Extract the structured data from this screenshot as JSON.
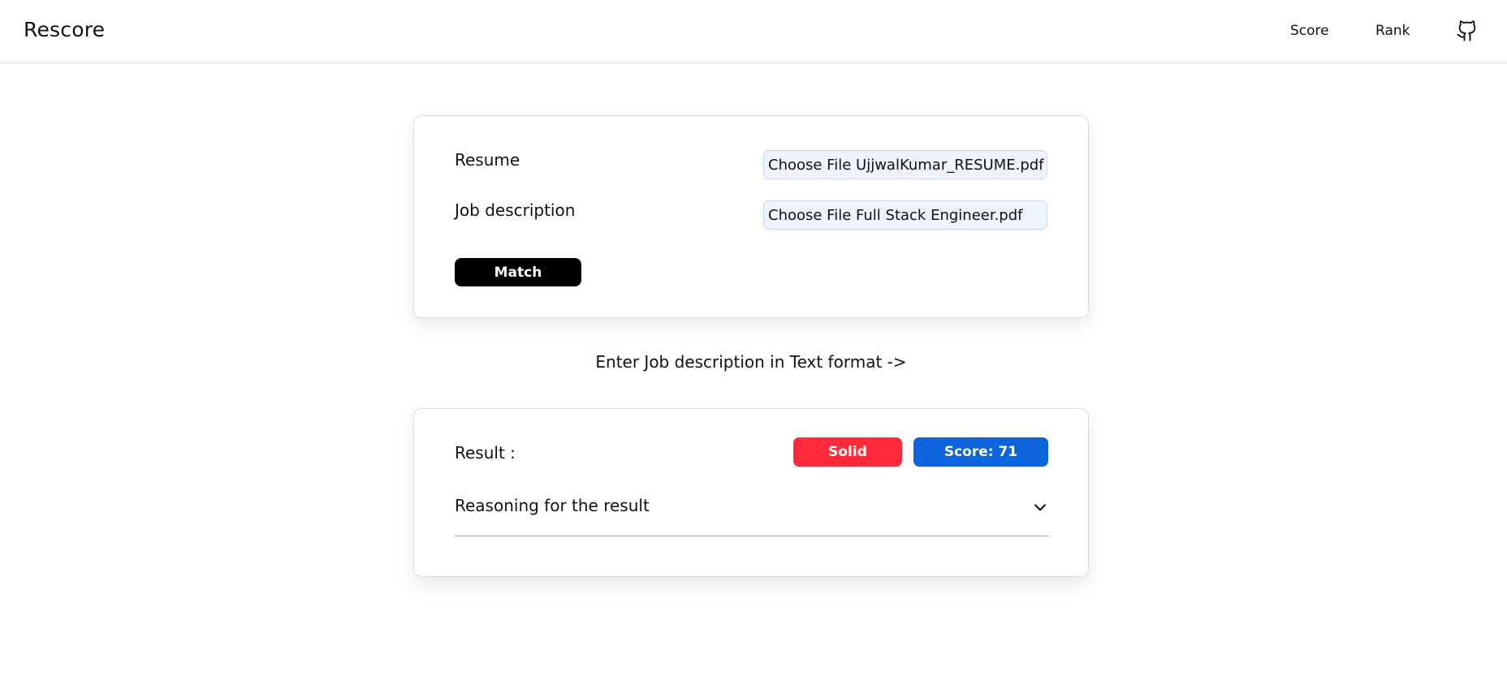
{
  "navbar": {
    "brand": "Rescore",
    "links": [
      {
        "label": "Score"
      },
      {
        "label": "Rank"
      }
    ],
    "github_icon": "github-icon"
  },
  "upload_form": {
    "resume_label": "Resume",
    "resume_file": "Choose File UjjwalKumar_RESUME.pdf",
    "job_description_label": "Job description",
    "job_description_file": "Choose File Full Stack Engineer.pdf",
    "match_button": "Match"
  },
  "job_text_link": "Enter Job description in Text format ->",
  "result": {
    "label": "Result :",
    "verdict_badge": "Solid",
    "score_badge": "Score: 71",
    "reasoning_label": "Reasoning for the result",
    "reasoning_icon": "chevron-down-icon"
  },
  "colors": {
    "verdict_badge": "#ff2a3b",
    "score_badge": "#0d64db",
    "match_button": "#000000",
    "file_input_bg": "#eef4ff"
  }
}
